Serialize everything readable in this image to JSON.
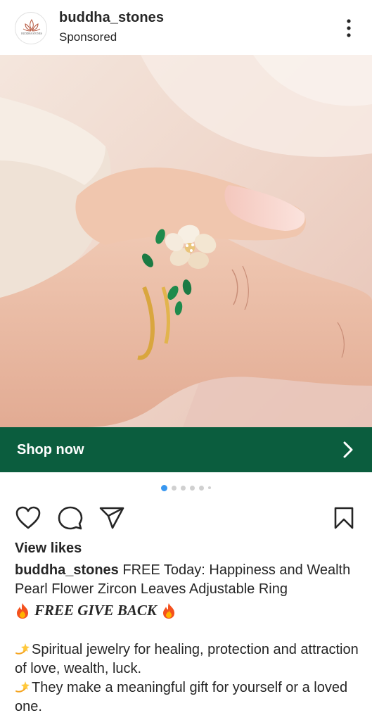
{
  "post": {
    "username": "buddha_stones",
    "sponsored_label": "Sponsored",
    "avatar_text": "BUDDHA STONES",
    "cta_label": "Shop now",
    "carousel": {
      "count": 6,
      "active_index": 1
    },
    "likes_label": "View likes",
    "caption_user": "buddha_stones",
    "caption_text": " FREE Today: Happiness and Wealth Pearl Flower Zircon Leaves Adjustable Ring",
    "giveback_text": "FREE GIVE BACK",
    "body_line1": "Spiritual jewelry for healing, protection and attraction of love, wealth, luck.",
    "body_line2": "They make a meaningful gift for yourself or a loved one."
  },
  "icons": {
    "more": "more-vertical-icon",
    "heart": "heart-icon",
    "comment": "comment-icon",
    "share": "share-icon",
    "save": "bookmark-icon",
    "chevron": "chevron-right-icon",
    "fire": "fire-emoji",
    "sparkle": "dizzy-emoji"
  },
  "colors": {
    "cta_background": "#0b5d3e",
    "active_dot": "#3897f0",
    "text": "#262626"
  }
}
